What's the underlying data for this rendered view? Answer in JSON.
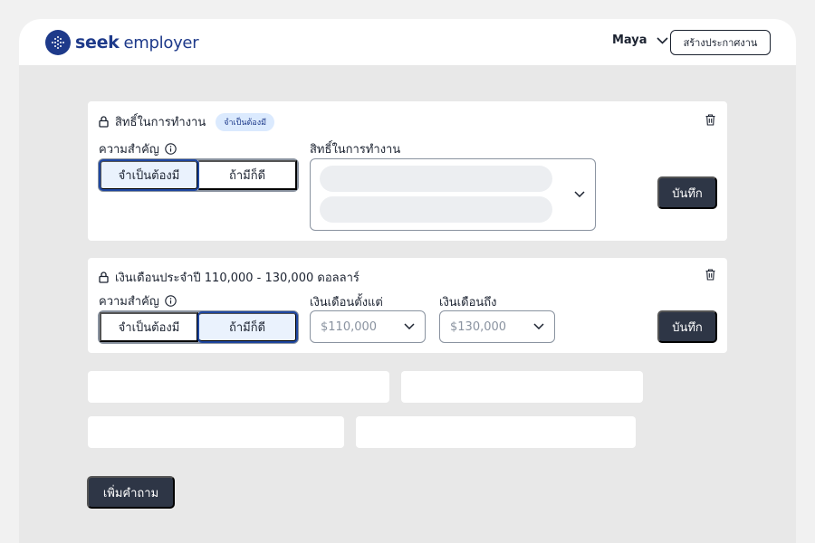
{
  "header": {
    "logo_bold": "seek",
    "logo_light": "employer",
    "user_name": "Maya",
    "create_job_label": "สร้างประกาศงาน"
  },
  "cards": [
    {
      "title": "สิทธิ์ในการทำงาน",
      "badge": "จำเป็นต้องมี",
      "importance_label": "ความสำคัญ",
      "options": [
        "จำเป็นต้องมี",
        "ถ้ามีก็ดี"
      ],
      "selected_option": "จำเป็นต้องมี",
      "field_label": "สิทธิ์ในการทำงาน",
      "save_label": "บันทึก"
    },
    {
      "title": "เงินเดือนประจำปี 110,000 - 130,000 ดอลลาร์",
      "importance_label": "ความสำคัญ",
      "options": [
        "จำเป็นต้องมี",
        "ถ้ามีก็ดี"
      ],
      "selected_option": "ถ้ามีก็ดี",
      "salary_from_label": "เงินเดือนตั้งแต่",
      "salary_from_value": "$110,000",
      "salary_to_label": "เงินเดือนถึง",
      "salary_to_value": "$130,000",
      "save_label": "บันทึก"
    }
  ],
  "add_question_label": "เพิ่มคำถาม",
  "icons": [
    "logo-icon",
    "chevron-down-icon",
    "lock-icon",
    "trash-icon",
    "info-icon"
  ],
  "colors": {
    "brand": "#1e3a8a",
    "dark_button": "#2e3646",
    "selected_fill": "#eaf2fd",
    "selected_border": "#1e46a0",
    "badge_bg": "#dbeafe"
  }
}
